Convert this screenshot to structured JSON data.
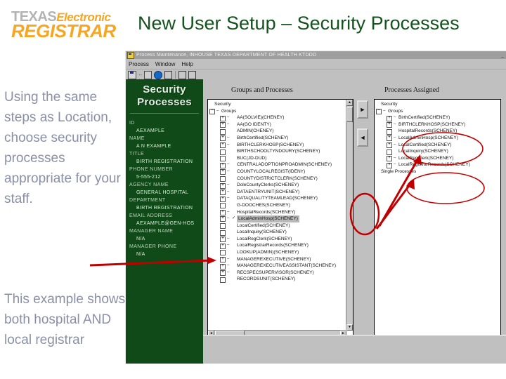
{
  "slide": {
    "title": "New User Setup – Security Processes",
    "title_color": "#14521e",
    "logo": {
      "line1_a": "TEXAS",
      "line1_b": "Electronic",
      "line2": "REGISTRAR",
      "gray": "#b3b3b3",
      "orange": "#f5a623"
    },
    "notes": [
      "Using the same steps as Location, choose security processes appropriate for your staff.",
      "This example shows both hospital AND local registrar"
    ],
    "note_color": "#8a8fa6"
  },
  "app": {
    "titlebar": {
      "text": "Process Maintenance, INHOUSE TEXAS DEPARTMENT OF HEALTH   KTDDD",
      "icon": "app-window-icon",
      "minimize_label": "_"
    },
    "menu": [
      "Process",
      "Window",
      "Help"
    ],
    "toolbar_icons": [
      "save-icon",
      "ellipsis-icon",
      "refresh-icon",
      "globe-icon",
      "person-icon",
      "clock-icon",
      "chart-icon"
    ],
    "profile": {
      "heading_line1": "Security",
      "heading_line2": "Processes",
      "fields": [
        {
          "label": "ID",
          "value": "AEXAMPLE"
        },
        {
          "label": "NAME",
          "value": "A N EXAMPLE"
        },
        {
          "label": "TITLE",
          "value": "BIRTH REGISTRATION"
        },
        {
          "label": "PHONE NUMBER",
          "value": "5-555-212"
        },
        {
          "label": "AGENCY NAME",
          "value": "GENERAL HOSPITAL"
        },
        {
          "label": "DEPARTMENT",
          "value": "BIRTH REGISTRATION"
        },
        {
          "label": "EMAIL ADDRESS",
          "value": "AEXAMPLE@GEN-HOS"
        },
        {
          "label": "MANAGER NAME",
          "value": "N/A"
        },
        {
          "label": "MANAGER PHONE",
          "value": "N/A"
        }
      ]
    },
    "groups_panel": {
      "heading": "Groups and Processes",
      "root": "Security",
      "branch": "Groups",
      "items": [
        {
          "label": "AA(SOLVIE)(CHENEY)",
          "expandable": true,
          "selected": false,
          "checked": false
        },
        {
          "label": "AA(GO IDENTY)",
          "expandable": true,
          "selected": false,
          "checked": false
        },
        {
          "label": "ADMIN(CHENEY)",
          "expandable": false,
          "selected": false,
          "checked": false
        },
        {
          "label": "BirthCertified(SCHENEY)",
          "expandable": true,
          "selected": false,
          "checked": false
        },
        {
          "label": "BIRTHCLERKHOSP(SCHENEY)",
          "expandable": true,
          "selected": false,
          "checked": false
        },
        {
          "label": "BIRTHSCHOOLTYNDOURY(SCHENEY)",
          "expandable": false,
          "selected": false,
          "checked": false
        },
        {
          "label": "BUC(JD-DUD)",
          "expandable": false,
          "selected": false,
          "checked": false
        },
        {
          "label": "CENTRALADOPTIONPROADMIN(SCHENEY)",
          "expandable": true,
          "selected": false,
          "checked": false
        },
        {
          "label": "COUNTYLOCALREGIST(IDENY)",
          "expandable": true,
          "selected": false,
          "checked": false
        },
        {
          "label": "COUNTYDISTRICTCLERK(SCHENEY)",
          "expandable": false,
          "selected": false,
          "checked": false
        },
        {
          "label": "DoleCountyClerks(SCHENEY)",
          "expandable": true,
          "selected": false,
          "checked": false
        },
        {
          "label": "DATAENTRYUNIT(SCHENEY)",
          "expandable": true,
          "selected": false,
          "checked": false
        },
        {
          "label": "DATAQUALITYTEAMLEAD(SCHENEY)",
          "expandable": true,
          "selected": false,
          "checked": false
        },
        {
          "label": "G-DOOCHES(SCHENEY)",
          "expandable": false,
          "selected": false,
          "checked": false
        },
        {
          "label": "HospitalRecords(SCHENEY)",
          "expandable": true,
          "selected": false,
          "checked": false
        },
        {
          "label": "LocalAdminHosp(SCHENEY)",
          "expandable": true,
          "selected": true,
          "checked": true
        },
        {
          "label": "LocalCertified(SCHENEY)",
          "expandable": false,
          "selected": false,
          "checked": false
        },
        {
          "label": "LocalInquiry(SCHENEY)",
          "expandable": false,
          "selected": false,
          "checked": false
        },
        {
          "label": "LocalRegClerk(SCHENEY)",
          "expandable": true,
          "selected": false,
          "checked": false
        },
        {
          "label": "LocalRegistrarRecords(SCHENEY)",
          "expandable": true,
          "selected": false,
          "checked": false
        },
        {
          "label": "LOOKUP(ADMIN)(SCHENEY)",
          "expandable": false,
          "selected": false,
          "checked": false
        },
        {
          "label": "MANAGEREXECUTIVE(SCHENEY)",
          "expandable": true,
          "selected": false,
          "checked": false
        },
        {
          "label": "MANAGEREXECUTIVEASSISTANT(SCHENEY)",
          "expandable": true,
          "selected": false,
          "checked": false
        },
        {
          "label": "RECSPECSUPERVISOR(SCHENEY)",
          "expandable": true,
          "selected": false,
          "checked": false
        },
        {
          "label": "RECORDSUNIT(SCHENEY)",
          "expandable": false,
          "selected": false,
          "checked": false
        }
      ]
    },
    "assigned_panel": {
      "heading": "Processes Assigned",
      "root": "Security",
      "branch": "Groups",
      "items": [
        {
          "label": "BirthCertified(SCHENEY)",
          "expandable": true
        },
        {
          "label": "BIRTHCLERKHOSP(SCHENEY)",
          "expandable": true
        },
        {
          "label": "HospitalRecords(SCHENEY)",
          "expandable": false
        },
        {
          "label": "LocalAdminHosp(SCHENEY)",
          "expandable": true
        },
        {
          "label": "LocalCertified(SCHENEY)",
          "expandable": true
        },
        {
          "label": "LocalInquiry(SCHENEY)",
          "expandable": false
        },
        {
          "label": "LocalRegClerk(SCHENEY)",
          "expandable": true
        },
        {
          "label": "LocalRegistrarRecords(SCHENEY)",
          "expandable": true
        }
      ],
      "footer": "Single Processes"
    },
    "transfer": {
      "add_label": "►",
      "remove_label": "◄"
    },
    "annotation_color": "#c00000"
  }
}
